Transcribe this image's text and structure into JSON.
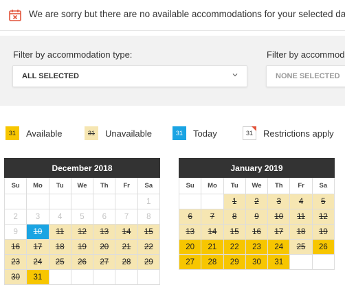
{
  "notice": {
    "icon": "calendar-x-icon",
    "message": "We are sorry but there are no available accommodations for your selected dates – plea"
  },
  "filters": [
    {
      "label": "Filter by accommodation type:",
      "value": "ALL SELECTED"
    },
    {
      "label": "Filter by accommoda",
      "value": "NONE SELECTED"
    }
  ],
  "legend": [
    {
      "type": "avail",
      "num": "31",
      "label": "Available"
    },
    {
      "type": "unavail",
      "num": "31",
      "label": "Unavailable"
    },
    {
      "type": "today",
      "num": "31",
      "label": "Today"
    },
    {
      "type": "restr",
      "num": "31",
      "label": "Restrictions apply"
    }
  ],
  "colors": {
    "available": "#f7c600",
    "unavailable": "#f6e6b2",
    "today": "#1aa4e3",
    "restriction": "#e2543b",
    "header": "#333333"
  },
  "weekdays": [
    "Su",
    "Mo",
    "Tu",
    "We",
    "Th",
    "Fr",
    "Sa"
  ],
  "calendars": [
    {
      "title": "December 2018",
      "weeks": [
        [
          [
            "",
            ""
          ],
          [
            "",
            ""
          ],
          [
            "",
            ""
          ],
          [
            "",
            ""
          ],
          [
            "",
            ""
          ],
          [
            "",
            ""
          ],
          [
            "1",
            "past"
          ]
        ],
        [
          [
            "2",
            "past"
          ],
          [
            "3",
            "past"
          ],
          [
            "4",
            "past"
          ],
          [
            "5",
            "past"
          ],
          [
            "6",
            "past"
          ],
          [
            "7",
            "past"
          ],
          [
            "8",
            "past"
          ]
        ],
        [
          [
            "9",
            "past"
          ],
          [
            "10",
            "today"
          ],
          [
            "11",
            "unavail"
          ],
          [
            "12",
            "unavail"
          ],
          [
            "13",
            "unavail"
          ],
          [
            "14",
            "unavail"
          ],
          [
            "15",
            "unavail"
          ]
        ],
        [
          [
            "16",
            "unavail"
          ],
          [
            "17",
            "unavail"
          ],
          [
            "18",
            "unavail"
          ],
          [
            "19",
            "unavail"
          ],
          [
            "20",
            "unavail"
          ],
          [
            "21",
            "unavail"
          ],
          [
            "22",
            "unavail"
          ]
        ],
        [
          [
            "23",
            "unavail"
          ],
          [
            "24",
            "unavail"
          ],
          [
            "25",
            "unavail"
          ],
          [
            "26",
            "unavail"
          ],
          [
            "27",
            "unavail"
          ],
          [
            "28",
            "unavail"
          ],
          [
            "29",
            "unavail"
          ]
        ],
        [
          [
            "30",
            "unavail"
          ],
          [
            "31",
            "avail"
          ],
          [
            "",
            ""
          ],
          [
            "",
            ""
          ],
          [
            "",
            ""
          ],
          [
            "",
            ""
          ],
          [
            "",
            ""
          ]
        ]
      ]
    },
    {
      "title": "January 2019",
      "weeks": [
        [
          [
            "",
            ""
          ],
          [
            "",
            ""
          ],
          [
            "1",
            "unavail"
          ],
          [
            "2",
            "unavail"
          ],
          [
            "3",
            "unavail"
          ],
          [
            "4",
            "unavail"
          ],
          [
            "5",
            "unavail"
          ]
        ],
        [
          [
            "6",
            "unavail"
          ],
          [
            "7",
            "unavail"
          ],
          [
            "8",
            "unavail"
          ],
          [
            "9",
            "unavail"
          ],
          [
            "10",
            "unavail"
          ],
          [
            "11",
            "unavail"
          ],
          [
            "12",
            "unavail"
          ]
        ],
        [
          [
            "13",
            "unavail"
          ],
          [
            "14",
            "unavail"
          ],
          [
            "15",
            "unavail"
          ],
          [
            "16",
            "unavail"
          ],
          [
            "17",
            "unavail"
          ],
          [
            "18",
            "unavail"
          ],
          [
            "19",
            "unavail"
          ]
        ],
        [
          [
            "20",
            "avail"
          ],
          [
            "21",
            "avail"
          ],
          [
            "22",
            "avail"
          ],
          [
            "23",
            "avail"
          ],
          [
            "24",
            "avail"
          ],
          [
            "25",
            "unavail"
          ],
          [
            "26",
            "avail"
          ]
        ],
        [
          [
            "27",
            "avail"
          ],
          [
            "28",
            "avail"
          ],
          [
            "29",
            "avail"
          ],
          [
            "30",
            "avail"
          ],
          [
            "31",
            "avail"
          ],
          [
            "",
            ""
          ],
          [
            "",
            ""
          ]
        ]
      ]
    }
  ]
}
